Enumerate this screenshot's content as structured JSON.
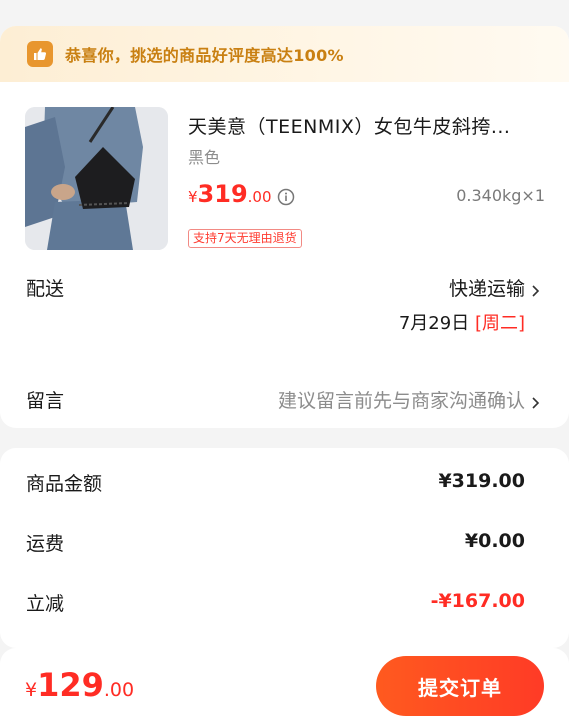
{
  "banner": {
    "text": "恭喜你，挑选的商品好评度高达100%",
    "icon": "thumbs-up-icon",
    "color": "#e8962e"
  },
  "product": {
    "title": "天美意（TEENMIX）女包牛皮斜挎...",
    "spec": "黑色",
    "price": {
      "symbol": "¥",
      "integer": "319",
      "decimal": ".00"
    },
    "weight_qty": "0.340kg×1",
    "badge": "支持7天无理由退货",
    "info_icon": "info-circle-icon"
  },
  "delivery": {
    "label": "配送",
    "method": "快递运输",
    "date": "7月29日",
    "weekday": "[周二]"
  },
  "message": {
    "label": "留言",
    "placeholder": "建议留言前先与商家沟通确认"
  },
  "summary": {
    "goods_label": "商品金额",
    "goods_value": "¥319.00",
    "shipping_label": "运费",
    "shipping_value": "¥0.00",
    "discount_label": "立减",
    "discount_value": "-¥167.00"
  },
  "footer": {
    "total": {
      "symbol": "¥",
      "integer": "129",
      "decimal": ".00"
    },
    "submit_label": "提交订单"
  },
  "colors": {
    "price_red": "#ff2c24",
    "button": "#ff4a22",
    "banner_text": "#c98012"
  }
}
